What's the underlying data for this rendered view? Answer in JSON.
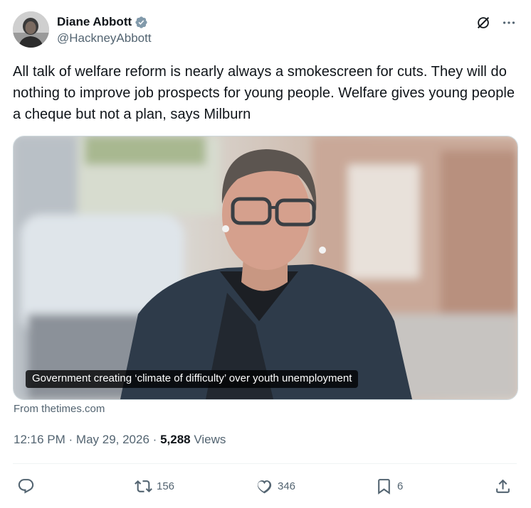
{
  "author": {
    "display_name": "Diane Abbott",
    "handle": "@HackneyAbbott",
    "verified": true
  },
  "header_icons": {
    "grok": "grok-icon",
    "more": "more-icon"
  },
  "tweet": {
    "text": "All talk of welfare reform is nearly always a smokescreen for cuts. They will do nothing to improve job prospects for young people. Welfare gives young people a cheque but not a plan, says Milburn"
  },
  "card": {
    "caption": "Government creating ‘climate of difficulty’ over youth unemployment",
    "source": "From thetimes.com"
  },
  "meta": {
    "time": "12:16 PM",
    "separator": "·",
    "date": "May 29, 2026",
    "views_count": "5,288",
    "views_label": "Views"
  },
  "actions": {
    "reply": {
      "icon": "reply-icon",
      "count": ""
    },
    "retweet": {
      "icon": "retweet-icon",
      "count": "156"
    },
    "like": {
      "icon": "like-icon",
      "count": "346"
    },
    "bookmark": {
      "icon": "bookmark-icon",
      "count": "6"
    },
    "share": {
      "icon": "share-icon",
      "count": ""
    }
  },
  "colors": {
    "text_primary": "#0f1419",
    "text_secondary": "#536471",
    "verified": "#829aab",
    "border": "#cfd9de"
  }
}
